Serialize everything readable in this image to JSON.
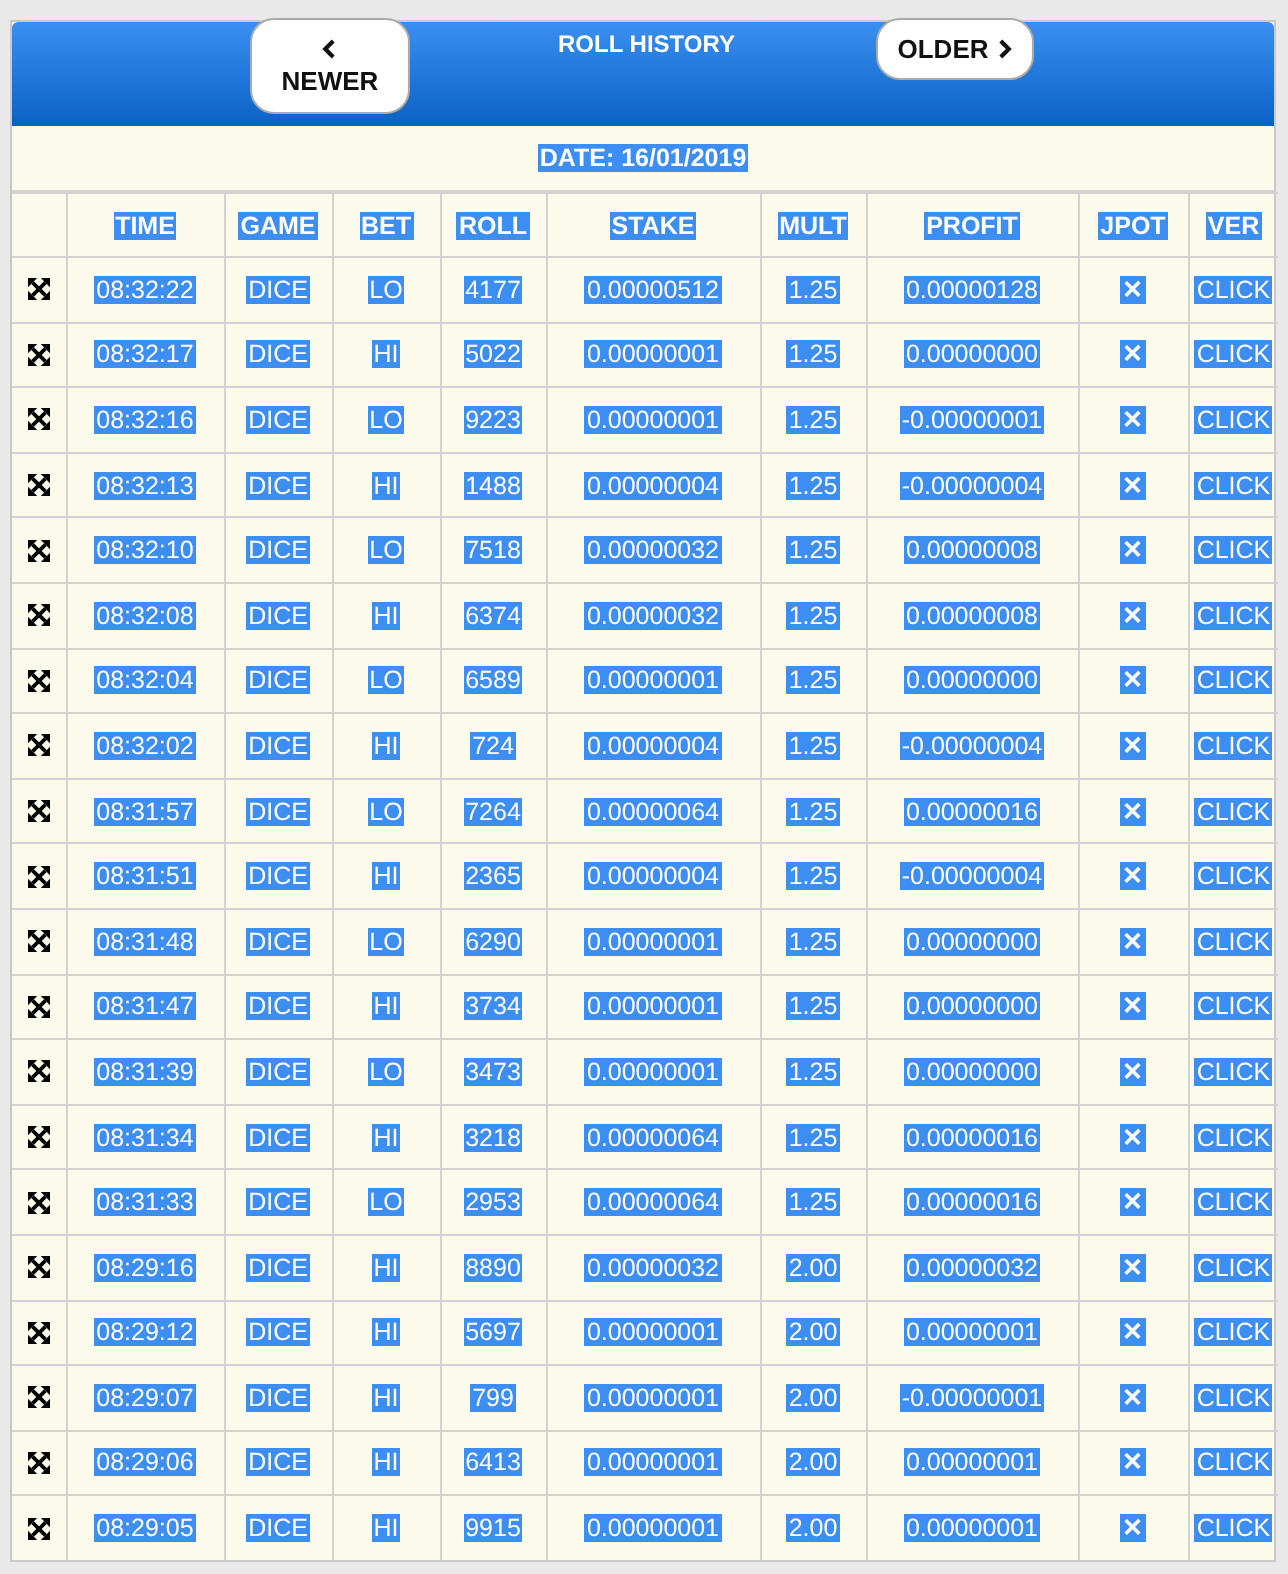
{
  "header": {
    "title": "ROLL HISTORY",
    "newer_button": "NEWER",
    "older_button": "OLDER"
  },
  "date": "DATE: 16/01/2019",
  "columns": [
    "TIME",
    "GAME",
    "BET",
    "ROLL",
    "STAKE",
    "MULT",
    "PROFIT",
    "JPOT",
    "VER"
  ],
  "rows": [
    {
      "cells": [
        "08:32:22",
        "DICE",
        "LO",
        "4177",
        "0.00000512",
        "1.25",
        "0.00000128",
        "✕",
        "CLICK"
      ]
    },
    {
      "cells": [
        "08:32:17",
        "DICE",
        "HI",
        "5022",
        "0.00000001",
        "1.25",
        "0.00000000",
        "✕",
        "CLICK"
      ]
    },
    {
      "cells": [
        "08:32:16",
        "DICE",
        "LO",
        "9223",
        "0.00000001",
        "1.25",
        "-0.00000001",
        "✕",
        "CLICK"
      ]
    },
    {
      "cells": [
        "08:32:13",
        "DICE",
        "HI",
        "1488",
        "0.00000004",
        "1.25",
        "-0.00000004",
        "✕",
        "CLICK"
      ]
    },
    {
      "cells": [
        "08:32:10",
        "DICE",
        "LO",
        "7518",
        "0.00000032",
        "1.25",
        "0.00000008",
        "✕",
        "CLICK"
      ]
    },
    {
      "cells": [
        "08:32:08",
        "DICE",
        "HI",
        "6374",
        "0.00000032",
        "1.25",
        "0.00000008",
        "✕",
        "CLICK"
      ]
    },
    {
      "cells": [
        "08:32:04",
        "DICE",
        "LO",
        "6589",
        "0.00000001",
        "1.25",
        "0.00000000",
        "✕",
        "CLICK"
      ]
    },
    {
      "cells": [
        "08:32:02",
        "DICE",
        "HI",
        "724",
        "0.00000004",
        "1.25",
        "-0.00000004",
        "✕",
        "CLICK"
      ]
    },
    {
      "cells": [
        "08:31:57",
        "DICE",
        "LO",
        "7264",
        "0.00000064",
        "1.25",
        "0.00000016",
        "✕",
        "CLICK"
      ]
    },
    {
      "cells": [
        "08:31:51",
        "DICE",
        "HI",
        "2365",
        "0.00000004",
        "1.25",
        "-0.00000004",
        "✕",
        "CLICK"
      ]
    },
    {
      "cells": [
        "08:31:48",
        "DICE",
        "LO",
        "6290",
        "0.00000001",
        "1.25",
        "0.00000000",
        "✕",
        "CLICK"
      ]
    },
    {
      "cells": [
        "08:31:47",
        "DICE",
        "HI",
        "3734",
        "0.00000001",
        "1.25",
        "0.00000000",
        "✕",
        "CLICK"
      ]
    },
    {
      "cells": [
        "08:31:39",
        "DICE",
        "LO",
        "3473",
        "0.00000001",
        "1.25",
        "0.00000000",
        "✕",
        "CLICK"
      ]
    },
    {
      "cells": [
        "08:31:34",
        "DICE",
        "HI",
        "3218",
        "0.00000064",
        "1.25",
        "0.00000016",
        "✕",
        "CLICK"
      ]
    },
    {
      "cells": [
        "08:31:33",
        "DICE",
        "LO",
        "2953",
        "0.00000064",
        "1.25",
        "0.00000016",
        "✕",
        "CLICK"
      ]
    },
    {
      "cells": [
        "08:29:16",
        "DICE",
        "HI",
        "8890",
        "0.00000032",
        "2.00",
        "0.00000032",
        "✕",
        "CLICK"
      ]
    },
    {
      "cells": [
        "08:29:12",
        "DICE",
        "HI",
        "5697",
        "0.00000001",
        "2.00",
        "0.00000001",
        "✕",
        "CLICK"
      ]
    },
    {
      "cells": [
        "08:29:07",
        "DICE",
        "HI",
        "799",
        "0.00000001",
        "2.00",
        "-0.00000001",
        "✕",
        "CLICK"
      ]
    },
    {
      "cells": [
        "08:29:06",
        "DICE",
        "HI",
        "6413",
        "0.00000001",
        "2.00",
        "0.00000001",
        "✕",
        "CLICK"
      ]
    },
    {
      "cells": [
        "08:29:05",
        "DICE",
        "HI",
        "9915",
        "0.00000001",
        "2.00",
        "0.00000001",
        "✕",
        "CLICK"
      ]
    }
  ]
}
